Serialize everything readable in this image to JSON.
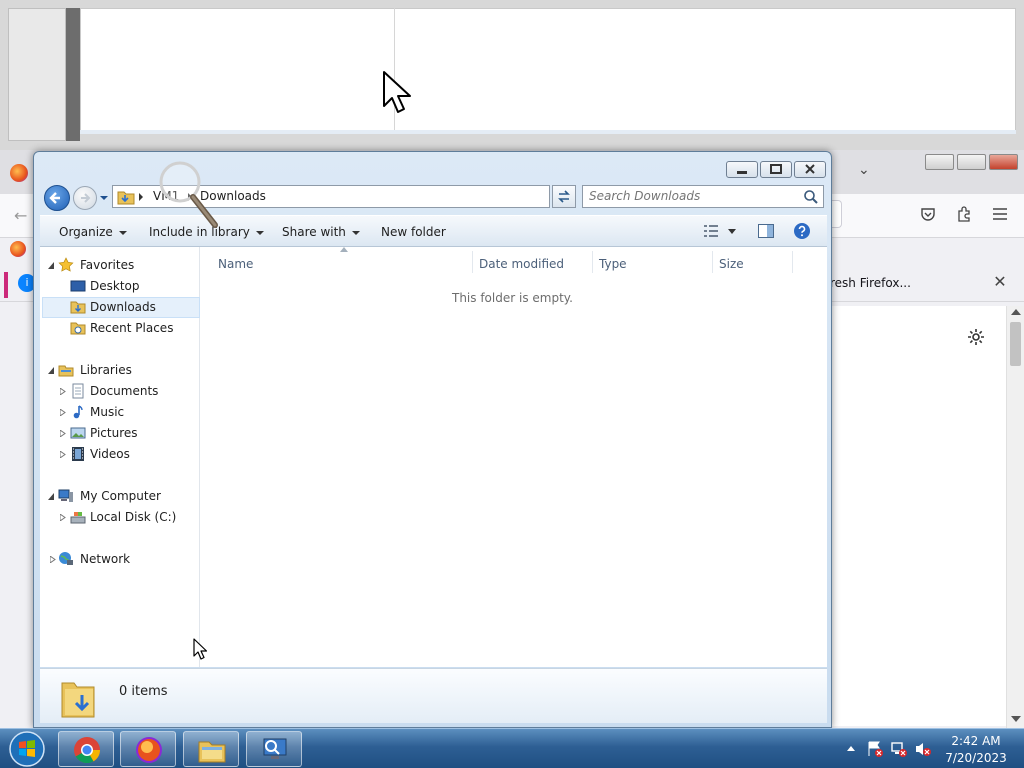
{
  "explorer": {
    "breadcrumb": [
      "VM1",
      "Downloads"
    ],
    "search_placeholder": "Search Downloads",
    "toolbar": {
      "organize": "Organize",
      "include_in_library": "Include in library",
      "share_with": "Share with",
      "new_folder": "New folder"
    },
    "nav": {
      "favorites": "Favorites",
      "desktop": "Desktop",
      "downloads": "Downloads",
      "recent_places": "Recent Places",
      "libraries": "Libraries",
      "documents": "Documents",
      "music": "Music",
      "pictures": "Pictures",
      "videos": "Videos",
      "my_computer": "My Computer",
      "local_disk": "Local Disk (C:)",
      "network": "Network"
    },
    "columns": [
      "Name",
      "Date modified",
      "Type",
      "Size"
    ],
    "empty_message": "This folder is empty.",
    "item_count": "0 items"
  },
  "firefox": {
    "notice_text": "resh Firefox..."
  },
  "taskbar": {
    "time": "2:42 AM",
    "date": "7/20/2023"
  },
  "icons": {
    "back": "back-arrow-icon",
    "forward": "forward-arrow-icon",
    "search": "search-icon",
    "folder": "folder-icon",
    "star": "star-icon",
    "computer": "computer-icon",
    "network": "network-icon"
  },
  "colors": {
    "selection": "#e5f0fb",
    "taskbar": "#2e5f94",
    "chrome_blue": "#1f5fb5"
  }
}
